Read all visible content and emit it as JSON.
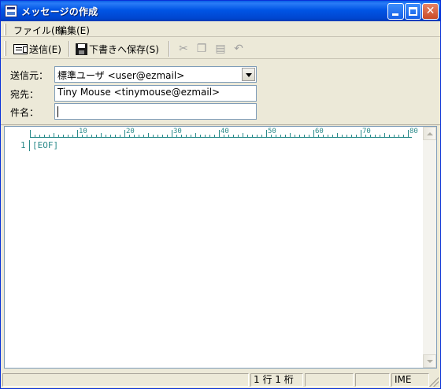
{
  "window": {
    "title": "メッセージの作成"
  },
  "menu": {
    "file": "ファイル(F)",
    "edit": "編集(E)"
  },
  "toolbar": {
    "send_label": "送信(E)",
    "save_label": "下書きへ保存(S)",
    "icons": [
      "cut-icon",
      "copy-icon",
      "paste-icon",
      "undo-icon"
    ]
  },
  "header": {
    "from_label": "送信元：",
    "from_value": "標準ユーザ <user@ezmail>",
    "to_label": "宛先：",
    "to_value": "Tiny Mouse <tinymouse@ezmail>",
    "subject_label": "件名：",
    "subject_value": ""
  },
  "editor": {
    "ruler_marks": [
      "10",
      "20",
      "30",
      "40",
      "50",
      "60",
      "70",
      "80"
    ],
    "line_number": "1",
    "eof_marker": "[EOF]"
  },
  "status": {
    "main": "",
    "position": "1 行 1 桁",
    "ime": "IME"
  },
  "colors": {
    "titlebar": "#0055e5",
    "editor_marker": "#2a8a8a"
  }
}
